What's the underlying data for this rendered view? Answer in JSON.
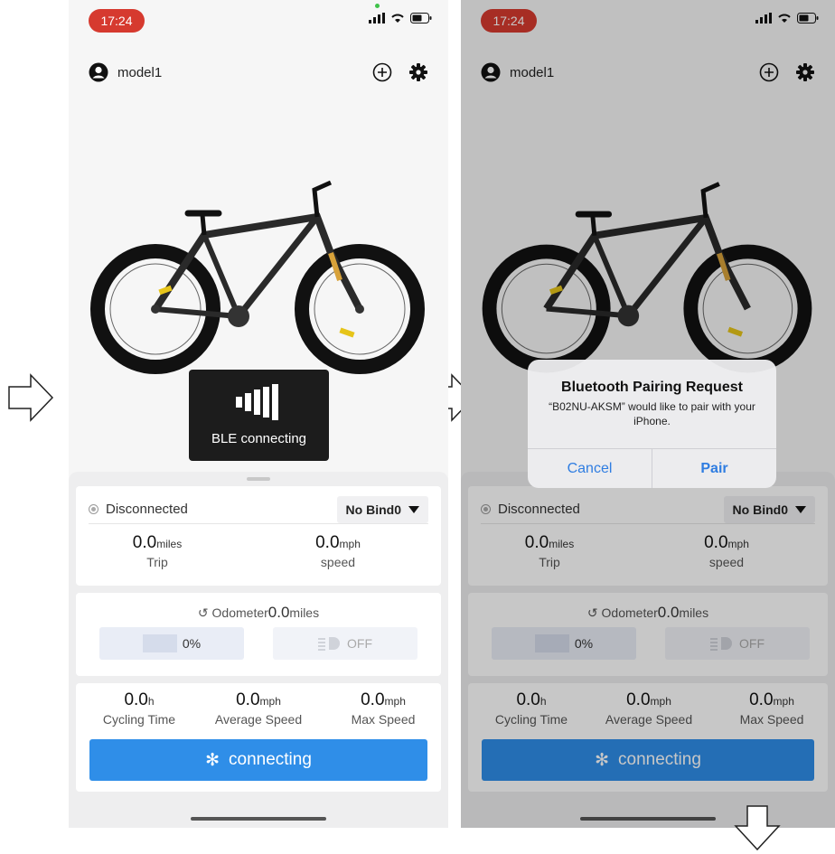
{
  "status_bar": {
    "time": "17:24"
  },
  "header": {
    "profile_name": "model1"
  },
  "toast": {
    "label": "BLE connecting"
  },
  "device": {
    "status": "Disconnected",
    "bind_select": "No Bind0"
  },
  "stats": {
    "trip": {
      "value": "0.0",
      "unit": "miles",
      "label": "Trip"
    },
    "speed": {
      "value": "0.0",
      "unit": "mph",
      "label": "speed"
    }
  },
  "odometer": {
    "label": "Odometer",
    "value": "0.0",
    "unit": "miles"
  },
  "battery": {
    "percent_text": "0%"
  },
  "light": {
    "state": "OFF"
  },
  "ride": {
    "cycling_time": {
      "value": "0.0",
      "unit": "h",
      "label": "Cycling Time"
    },
    "average_speed": {
      "value": "0.0",
      "unit": "mph",
      "label": "Average Speed"
    },
    "max_speed": {
      "value": "0.0",
      "unit": "mph",
      "label": "Max Speed"
    }
  },
  "connect_button": {
    "label": "connecting"
  },
  "pairing_alert": {
    "title": "Bluetooth Pairing Request",
    "message": "“B02NU-AKSM” would like to pair with your iPhone.",
    "cancel": "Cancel",
    "pair": "Pair"
  },
  "colors": {
    "accent": "#2f8ee8",
    "time_pill": "#d63a2f",
    "toast_bg": "#1c1c1c"
  }
}
